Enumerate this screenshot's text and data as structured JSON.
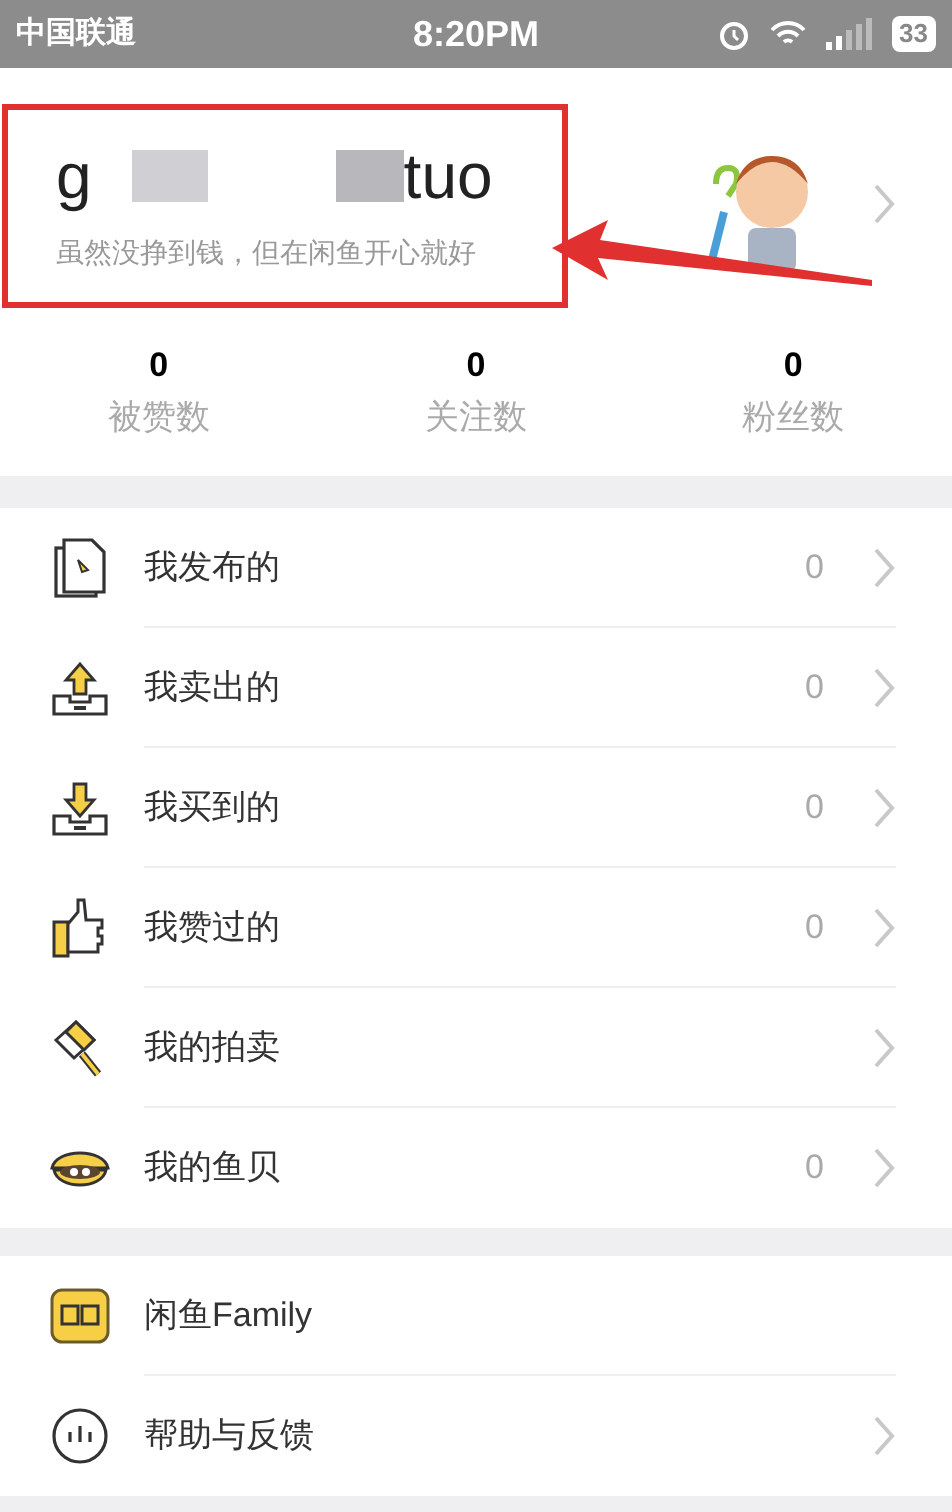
{
  "status_bar": {
    "carrier": "中国联通",
    "time": "8:20PM",
    "battery": "33"
  },
  "profile": {
    "name_start": "g",
    "name_end": "tuo",
    "motto": "虽然没挣到钱，但在闲鱼开心就好"
  },
  "stats": [
    {
      "value": "0",
      "label": "被赞数"
    },
    {
      "value": "0",
      "label": "关注数"
    },
    {
      "value": "0",
      "label": "粉丝数"
    }
  ],
  "menu": [
    {
      "kind": "published",
      "label": "我发布的",
      "count": "0"
    },
    {
      "kind": "sold",
      "label": "我卖出的",
      "count": "0"
    },
    {
      "kind": "bought",
      "label": "我买到的",
      "count": "0"
    },
    {
      "kind": "liked",
      "label": "我赞过的",
      "count": "0"
    },
    {
      "kind": "auction",
      "label": "我的拍卖"
    },
    {
      "kind": "shells",
      "label": "我的鱼贝",
      "count": "0"
    }
  ],
  "menu2": [
    {
      "kind": "family",
      "label": "闲鱼Family",
      "chevron": false
    },
    {
      "kind": "help",
      "label": "帮助与反馈",
      "chevron": true
    }
  ]
}
